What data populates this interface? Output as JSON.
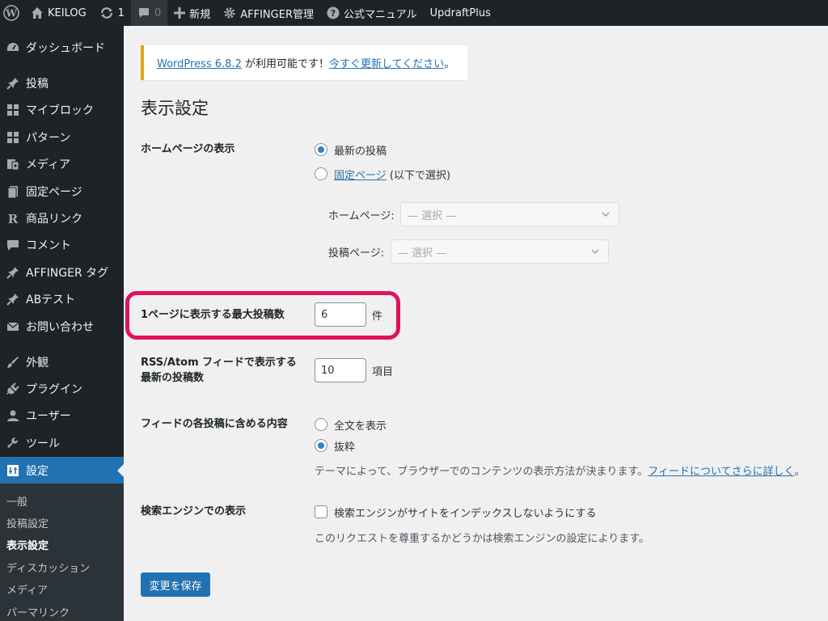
{
  "adminbar": {
    "site_name": "KEILOG",
    "updates_count": "1",
    "comments_count": "0",
    "new_label": "新規",
    "affinger_label": "AFFINGER管理",
    "manual_label": "公式マニュアル",
    "updraft_label": "UpdraftPlus"
  },
  "sidebar": {
    "items": [
      {
        "label": "ダッシュボード",
        "icon": "dashboard-icon"
      },
      {
        "label": "投稿",
        "icon": "pin-icon"
      },
      {
        "label": "マイブロック",
        "icon": "blocks-icon"
      },
      {
        "label": "パターン",
        "icon": "patterns-icon"
      },
      {
        "label": "メディア",
        "icon": "media-icon"
      },
      {
        "label": "固定ページ",
        "icon": "page-icon"
      },
      {
        "label": "商品リンク",
        "icon": "r-icon"
      },
      {
        "label": "コメント",
        "icon": "comment-icon"
      },
      {
        "label": "AFFINGER タグ",
        "icon": "pin-icon"
      },
      {
        "label": "ABテスト",
        "icon": "pin-icon"
      },
      {
        "label": "お問い合わせ",
        "icon": "mail-icon"
      },
      {
        "label": "外観",
        "icon": "brush-icon"
      },
      {
        "label": "プラグイン",
        "icon": "plugin-icon"
      },
      {
        "label": "ユーザー",
        "icon": "user-icon"
      },
      {
        "label": "ツール",
        "icon": "wrench-icon"
      },
      {
        "label": "設定",
        "icon": "settings-icon"
      }
    ],
    "submenu": [
      "一般",
      "投稿設定",
      "表示設定",
      "ディスカッション",
      "メディア",
      "パーマリンク"
    ]
  },
  "notice": {
    "version_link": "WordPress 6.8.2",
    "text": " が利用可能です！",
    "update_link": "今すぐ更新してください",
    "end": "。"
  },
  "page_title": "表示設定",
  "homepage": {
    "label": "ホームページの表示",
    "option_latest": "最新の投稿",
    "option_static_link": "固定ページ",
    "option_static_suffix": " (以下で選択)",
    "front_label": "ホームページ:",
    "front_placeholder": "— 選択 —",
    "posts_label": "投稿ページ:",
    "posts_placeholder": "— 選択 —"
  },
  "posts_per_page": {
    "label": "1ページに表示する最大投稿数",
    "value": "6",
    "unit": "件"
  },
  "rss": {
    "label_line1": "RSS/Atom フィードで表示する",
    "label_line2": "最新の投稿数",
    "value": "10",
    "unit": "項目"
  },
  "feed_content": {
    "label": "フィードの各投稿に含める内容",
    "option_full": "全文を表示",
    "option_excerpt": "抜粋",
    "description": "テーマによって、ブラウザーでのコンテンツの表示方法が決まります。",
    "link": "フィードについてさらに詳しく",
    "end": "。"
  },
  "search_engine": {
    "label": "検索エンジンでの表示",
    "checkbox_label": "検索エンジンがサイトをインデックスしないようにする",
    "description": "このリクエストを尊重するかどうかは検索エンジンの設定によります。"
  },
  "save_button": "変更を保存",
  "colors": {
    "adminbar_bg": "#1d2327",
    "accent": "#2271b1",
    "notice_border": "#dba617",
    "highlight": "#e0115f"
  }
}
